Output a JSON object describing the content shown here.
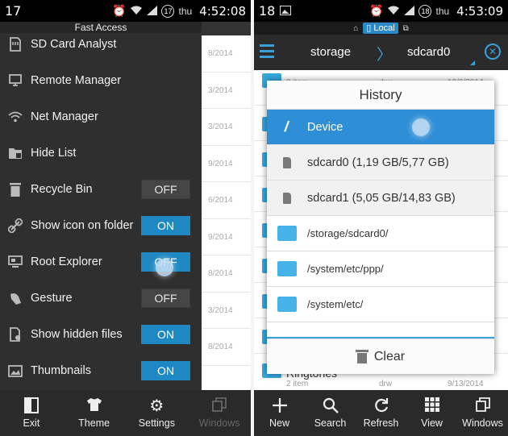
{
  "left": {
    "status": {
      "notif": "17",
      "badge": "17",
      "day": "thu",
      "time": "4:52:08"
    },
    "drawer_title": "Fast Access",
    "menu": [
      {
        "label": "SD Card Analyst",
        "icon": "sd-card-analyst-icon"
      },
      {
        "label": "Remote Manager",
        "icon": "remote-manager-icon"
      },
      {
        "label": "Net Manager",
        "icon": "net-manager-icon"
      },
      {
        "label": "Hide List",
        "icon": "hide-list-icon"
      },
      {
        "label": "Recycle Bin",
        "icon": "recycle-bin-icon",
        "toggle": "OFF"
      },
      {
        "label": "Show icon on folder",
        "icon": "folder-link-icon",
        "toggle": "ON"
      },
      {
        "label": "Root Explorer",
        "icon": "root-explorer-icon",
        "toggle": "OFF"
      },
      {
        "label": "Gesture",
        "icon": "gesture-icon",
        "toggle": "OFF"
      },
      {
        "label": "Show hidden files",
        "icon": "hidden-files-icon",
        "toggle": "ON"
      },
      {
        "label": "Thumbnails",
        "icon": "thumbnails-icon",
        "toggle": "ON"
      }
    ],
    "bg_dates": [
      "8/2014",
      "3/2014",
      "3/2014",
      "9/2014",
      "6/2014",
      "9/2014",
      "8/2014",
      "3/2014",
      "8/2014"
    ],
    "bottom": [
      {
        "label": "Exit"
      },
      {
        "label": "Theme"
      },
      {
        "label": "Settings"
      },
      {
        "label": "Windows"
      }
    ]
  },
  "right": {
    "status": {
      "notif": "18",
      "badge": "18",
      "day": "thu",
      "time": "4:53:09"
    },
    "location": "Local",
    "breadcrumb": [
      "storage",
      "sdcard0"
    ],
    "bg_top_meta": [
      "8 item",
      "drw",
      "10/9/2014"
    ],
    "bg_bottom": {
      "name": "Ringtones",
      "items": "2 item",
      "perm": "drw",
      "date": "9/13/2014"
    },
    "history": {
      "title": "History",
      "items": [
        {
          "label": "Device"
        },
        {
          "label": "sdcard0 (1,19 GB/5,77 GB)"
        },
        {
          "label": "sdcard1 (5,05 GB/14,83 GB)"
        },
        {
          "label": "/storage/sdcard0/"
        },
        {
          "label": "/system/etc/ppp/"
        },
        {
          "label": "/system/etc/"
        }
      ],
      "clear_label": "Clear"
    },
    "bottom": [
      {
        "label": "New"
      },
      {
        "label": "Search"
      },
      {
        "label": "Refresh"
      },
      {
        "label": "View"
      },
      {
        "label": "Windows"
      }
    ]
  },
  "colors": {
    "accent": "#1e88c3",
    "selected": "#2e8fd6",
    "folder": "#35a9e0"
  }
}
